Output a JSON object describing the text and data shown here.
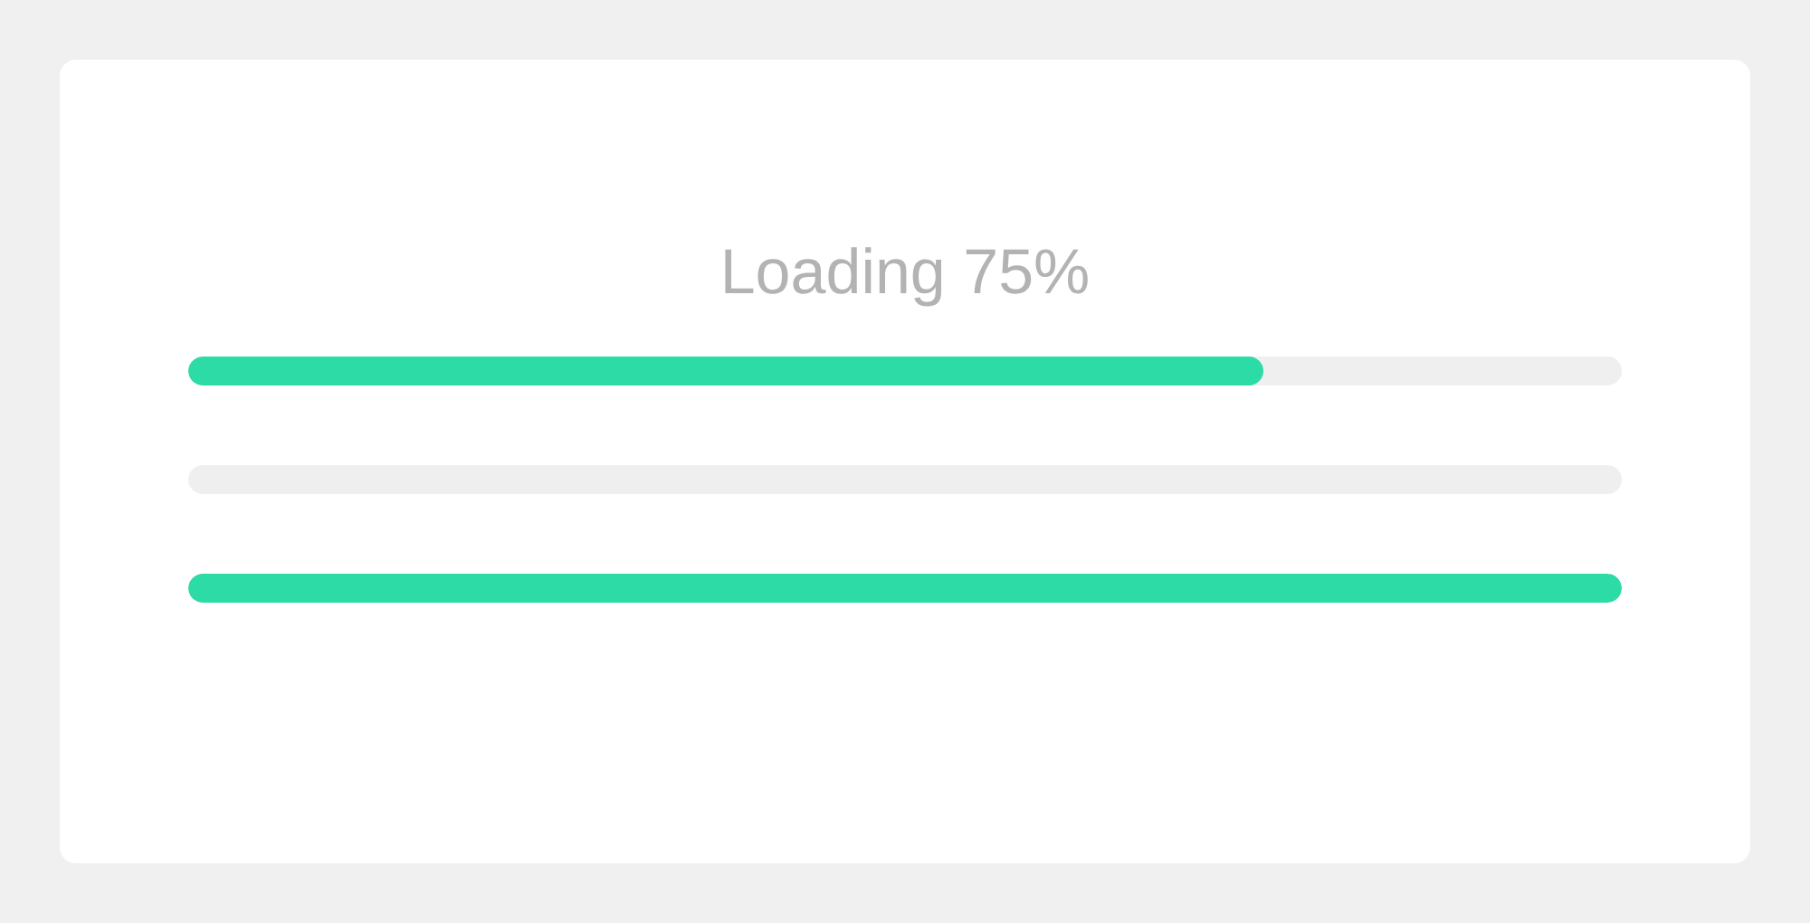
{
  "title": "Loading 75%",
  "progress_bars": [
    {
      "level": 0.75
    },
    {
      "level": 0
    },
    {
      "level": 1
    }
  ]
}
